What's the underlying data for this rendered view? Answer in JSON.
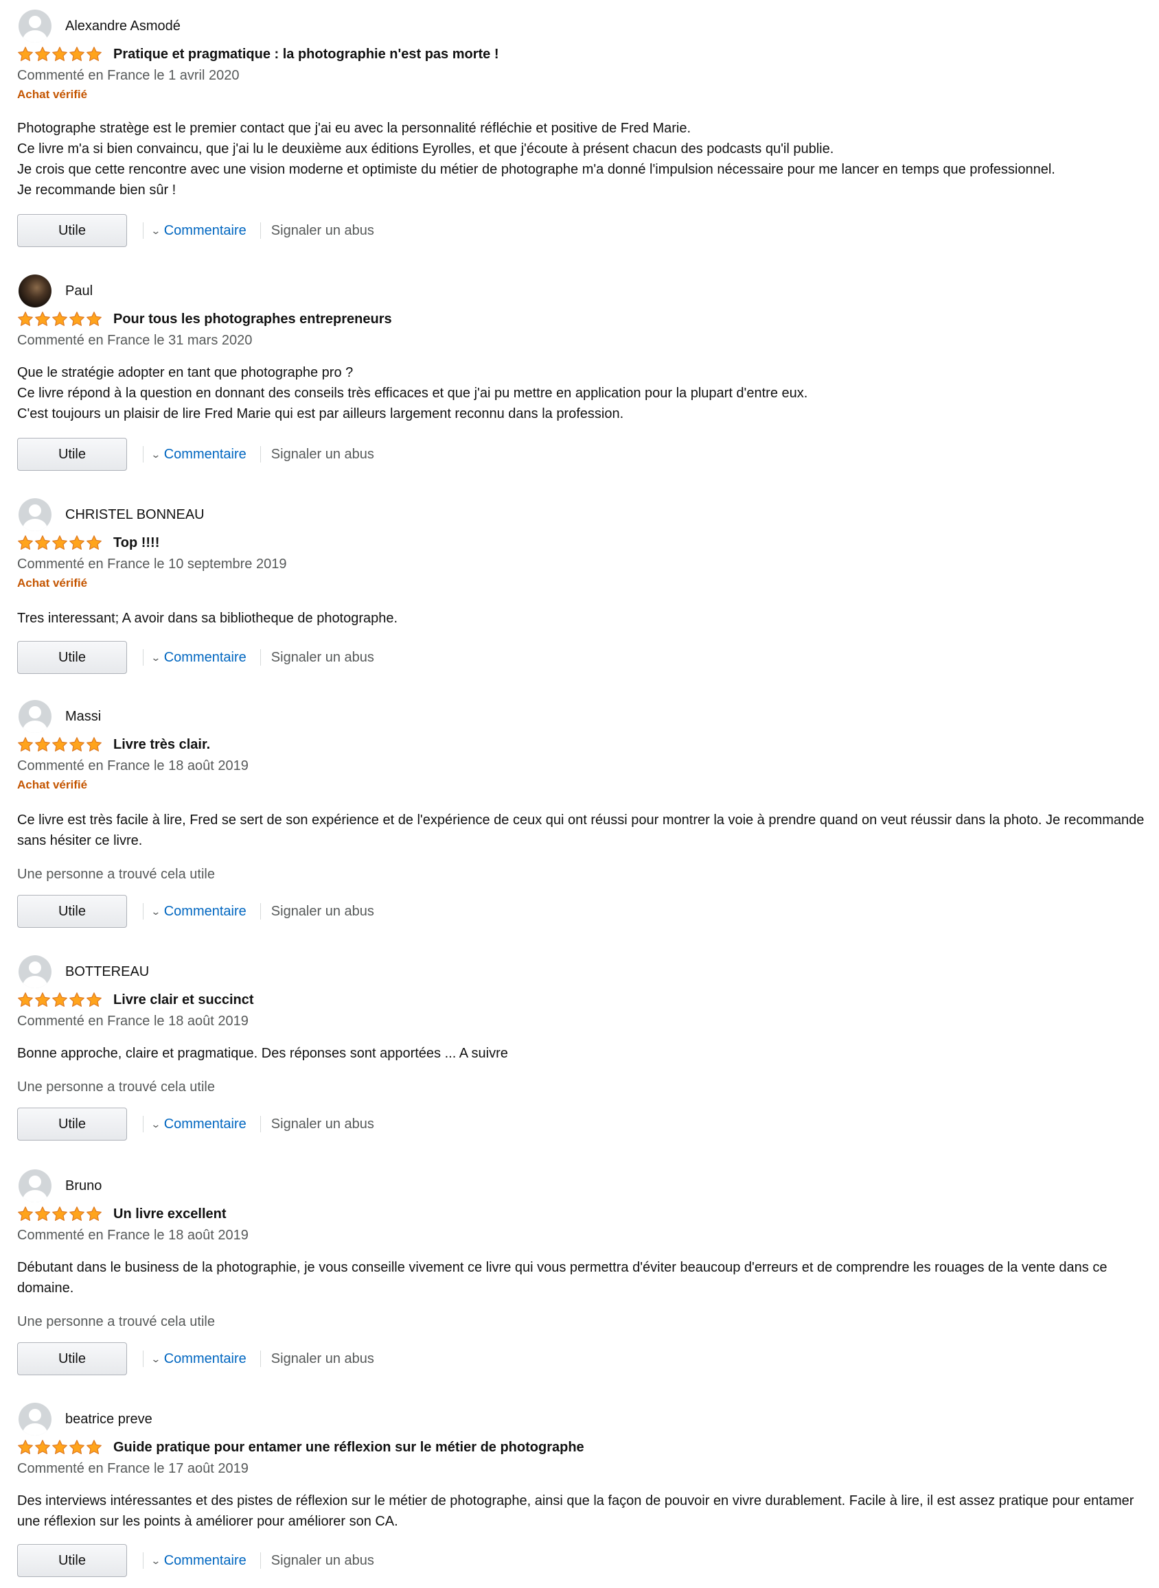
{
  "colors": {
    "star": "#ffa41c",
    "verified": "#c45500",
    "link": "#0066c0",
    "muted": "#565959"
  },
  "labels": {
    "helpful_button": "Utile",
    "comment": "Commentaire",
    "report": "Signaler un abus",
    "verified": "Achat vérifié",
    "helpful_count": "Une personne a trouvé cela utile"
  },
  "reviews": [
    {
      "author": "Alexandre Asmodé",
      "rating": 5,
      "title": "Pratique et pragmatique : la photographie n'est pas morte !",
      "date": "Commenté en France le 1 avril 2020",
      "body": [
        "Photographe stratège est le premier contact que j'ai eu avec la personnalité réfléchie et positive de Fred Marie.",
        "Ce livre m'a si bien convaincu, que j'ai lu le deuxième aux éditions Eyrolles, et que j'écoute à présent chacun des podcasts qu'il publie.",
        "Je crois que cette rencontre avec une vision moderne et optimiste du métier de photographe m'a donné l'impulsion nécessaire pour me lancer en temps que professionnel.",
        "Je recommande bien sûr !"
      ]
    },
    {
      "author": "Paul",
      "rating": 5,
      "title": "Pour tous les photographes entrepreneurs",
      "date": "Commenté en France le 31 mars 2020",
      "body": [
        "Que le stratégie adopter en tant que photographe pro ?",
        "Ce livre répond à la question en donnant des conseils très efficaces et que j'ai pu mettre en application pour la plupart d'entre eux.",
        "C'est toujours un plaisir de lire Fred Marie qui est par ailleurs largement reconnu dans la profession."
      ]
    },
    {
      "author": "CHRISTEL BONNEAU",
      "rating": 5,
      "title": "Top !!!!",
      "date": "Commenté en France le 10 septembre 2019",
      "body": [
        "Tres interessant; A avoir dans sa bibliotheque de photographe."
      ]
    },
    {
      "author": "Massi",
      "rating": 5,
      "title": "Livre très clair.",
      "date": "Commenté en France le 18 août 2019",
      "body": [
        "Ce livre est très facile à lire, Fred se sert de son expérience et de l'expérience de ceux qui ont réussi pour montrer la voie à prendre quand on veut réussir dans la photo. Je recommande sans hésiter ce livre."
      ]
    },
    {
      "author": "BOTTEREAU",
      "rating": 5,
      "title": "Livre clair et succinct",
      "date": "Commenté en France le 18 août 2019",
      "body": [
        "Bonne approche, claire et pragmatique. Des réponses sont apportées ... A suivre"
      ]
    },
    {
      "author": "Bruno",
      "rating": 5,
      "title": "Un livre excellent",
      "date": "Commenté en France le 18 août 2019",
      "body": [
        "Débutant dans le business de la photographie, je vous conseille vivement ce livre qui vous permettra d'éviter beaucoup d'erreurs et de comprendre les rouages de la vente dans ce domaine."
      ]
    },
    {
      "author": "beatrice preve",
      "rating": 5,
      "title": "Guide pratique pour entamer une réflexion sur le métier de photographe",
      "date": "Commenté en France le 17 août 2019",
      "body": [
        "Des interviews intéressantes et des pistes de réflexion sur le métier de photographe, ainsi que la façon de pouvoir en vivre durablement. Facile à lire, il est assez pratique pour entamer une réflexion sur les points à améliorer pour améliorer son CA."
      ]
    }
  ]
}
